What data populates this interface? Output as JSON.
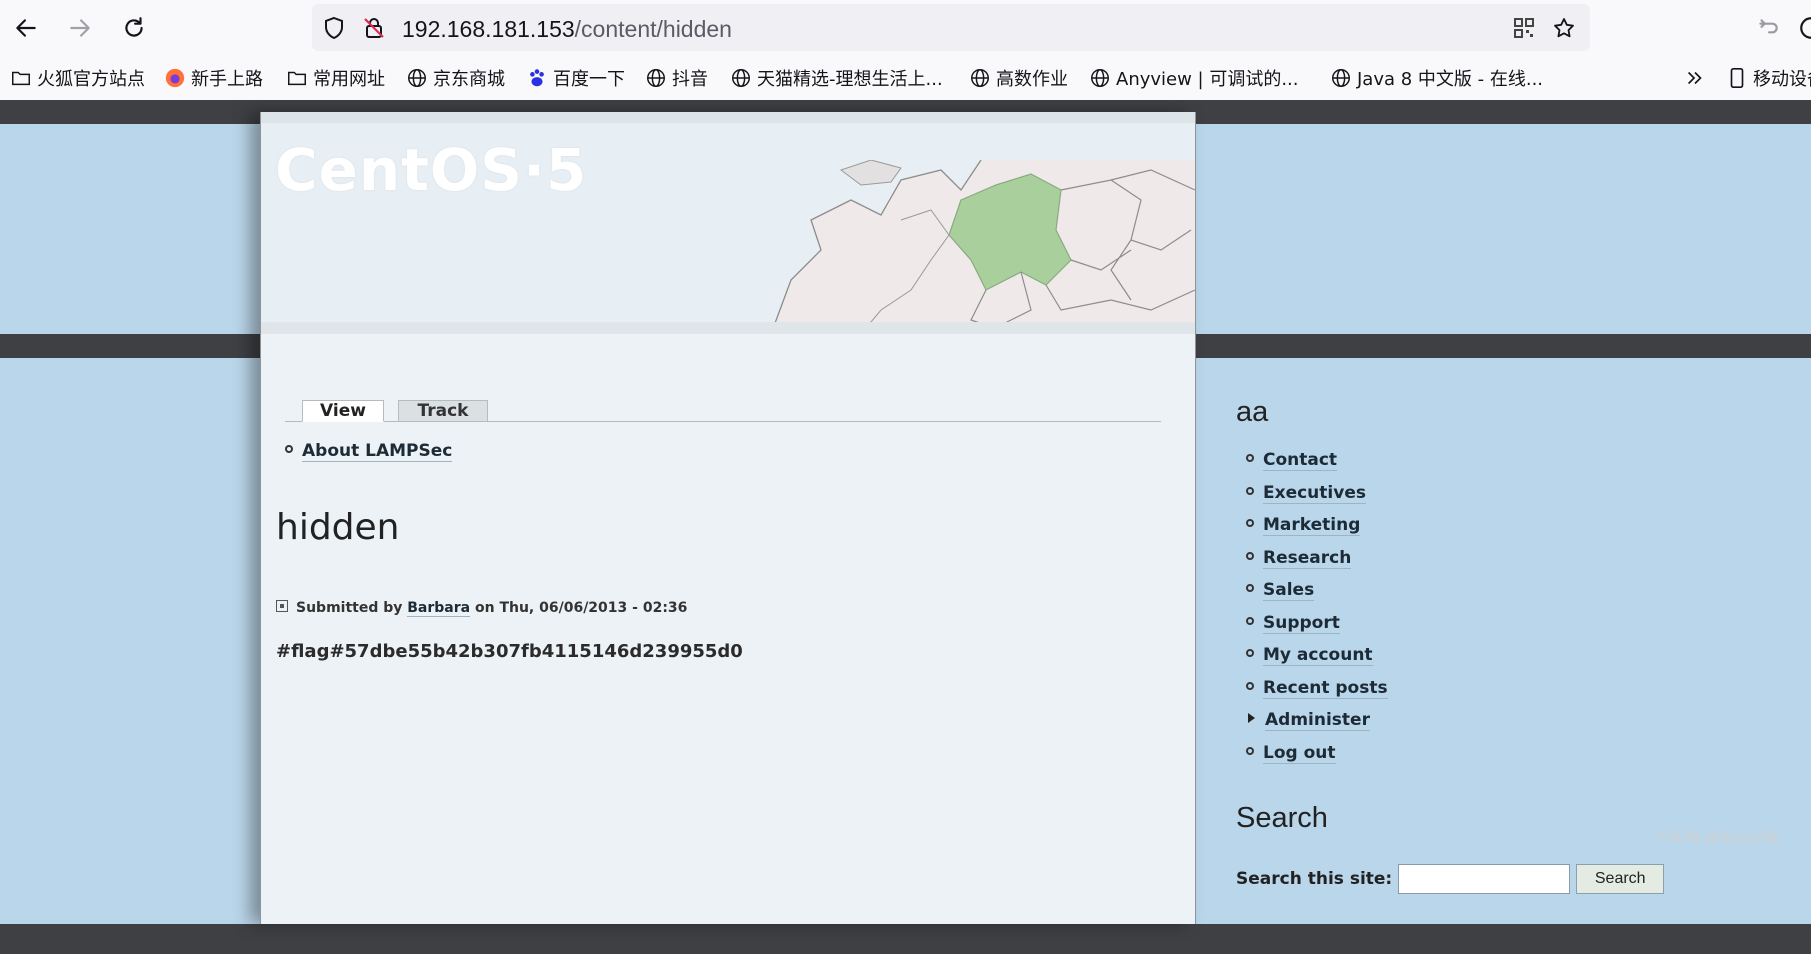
{
  "browser": {
    "url_host": "192.168.181.153",
    "url_path": "/content/hidden",
    "bookmarks": [
      {
        "label": "火狐官方站点",
        "icon": "folder-icon"
      },
      {
        "label": "新手上路",
        "icon": "firefox-icon"
      },
      {
        "label": "常用网址",
        "icon": "folder-icon"
      },
      {
        "label": "京东商城",
        "icon": "globe-icon"
      },
      {
        "label": "百度一下",
        "icon": "baidu-paw-icon"
      },
      {
        "label": "抖音",
        "icon": "globe-icon"
      },
      {
        "label": "天猫精选-理想生活上...",
        "icon": "globe-icon"
      },
      {
        "label": "高数作业",
        "icon": "globe-icon"
      },
      {
        "label": "Anyview | 可调试的...",
        "icon": "globe-icon"
      },
      {
        "label": "Java 8 中文版 - 在线...",
        "icon": "globe-icon"
      },
      {
        "label": "移动设备",
        "icon": "mobile-icon"
      }
    ]
  },
  "site": {
    "logo_text": "CentOS·5"
  },
  "tabs": [
    {
      "label": "View",
      "active": true
    },
    {
      "label": "Track",
      "active": false
    }
  ],
  "primary_links": [
    {
      "label": "About LAMPSec"
    }
  ],
  "node": {
    "title": "hidden",
    "submitted_prefix": "Submitted by",
    "author": "Barbara",
    "submitted_suffix": "on Thu, 06/06/2013 - 02:36",
    "body": "#flag#57dbe55b42b307fb4115146d239955d0"
  },
  "sidebar": {
    "user_block_title": "aa",
    "menu": [
      {
        "label": "Contact",
        "expandable": false
      },
      {
        "label": "Executives",
        "expandable": false
      },
      {
        "label": "Marketing",
        "expandable": false
      },
      {
        "label": "Research",
        "expandable": false
      },
      {
        "label": "Sales",
        "expandable": false
      },
      {
        "label": "Support",
        "expandable": false
      },
      {
        "label": "My account",
        "expandable": false
      },
      {
        "label": "Recent posts",
        "expandable": false
      },
      {
        "label": "Administer",
        "expandable": true
      },
      {
        "label": "Log out",
        "expandable": false
      }
    ],
    "search_title": "Search",
    "search_label": "Search this site:",
    "search_value": "",
    "search_button": "Search"
  },
  "watermark": "CSDN @川川小宝",
  "colors": {
    "page_background": "#bad6ea",
    "content_background": "#ecf2f6",
    "dark_band": "#3f4044",
    "map_highlight": "#a9cf9c"
  }
}
